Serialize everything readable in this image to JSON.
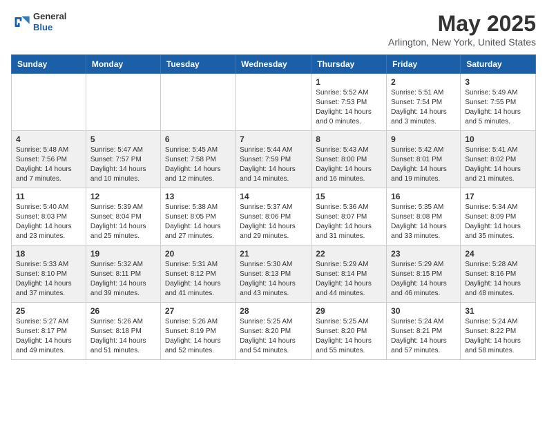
{
  "header": {
    "logo": {
      "general": "General",
      "blue": "Blue"
    },
    "title": "May 2025",
    "location": "Arlington, New York, United States"
  },
  "days_of_week": [
    "Sunday",
    "Monday",
    "Tuesday",
    "Wednesday",
    "Thursday",
    "Friday",
    "Saturday"
  ],
  "weeks": [
    [
      {
        "day": "",
        "info": ""
      },
      {
        "day": "",
        "info": ""
      },
      {
        "day": "",
        "info": ""
      },
      {
        "day": "",
        "info": ""
      },
      {
        "day": "1",
        "info": "Sunrise: 5:52 AM\nSunset: 7:53 PM\nDaylight: 14 hours and 0 minutes."
      },
      {
        "day": "2",
        "info": "Sunrise: 5:51 AM\nSunset: 7:54 PM\nDaylight: 14 hours and 3 minutes."
      },
      {
        "day": "3",
        "info": "Sunrise: 5:49 AM\nSunset: 7:55 PM\nDaylight: 14 hours and 5 minutes."
      }
    ],
    [
      {
        "day": "4",
        "info": "Sunrise: 5:48 AM\nSunset: 7:56 PM\nDaylight: 14 hours and 7 minutes."
      },
      {
        "day": "5",
        "info": "Sunrise: 5:47 AM\nSunset: 7:57 PM\nDaylight: 14 hours and 10 minutes."
      },
      {
        "day": "6",
        "info": "Sunrise: 5:45 AM\nSunset: 7:58 PM\nDaylight: 14 hours and 12 minutes."
      },
      {
        "day": "7",
        "info": "Sunrise: 5:44 AM\nSunset: 7:59 PM\nDaylight: 14 hours and 14 minutes."
      },
      {
        "day": "8",
        "info": "Sunrise: 5:43 AM\nSunset: 8:00 PM\nDaylight: 14 hours and 16 minutes."
      },
      {
        "day": "9",
        "info": "Sunrise: 5:42 AM\nSunset: 8:01 PM\nDaylight: 14 hours and 19 minutes."
      },
      {
        "day": "10",
        "info": "Sunrise: 5:41 AM\nSunset: 8:02 PM\nDaylight: 14 hours and 21 minutes."
      }
    ],
    [
      {
        "day": "11",
        "info": "Sunrise: 5:40 AM\nSunset: 8:03 PM\nDaylight: 14 hours and 23 minutes."
      },
      {
        "day": "12",
        "info": "Sunrise: 5:39 AM\nSunset: 8:04 PM\nDaylight: 14 hours and 25 minutes."
      },
      {
        "day": "13",
        "info": "Sunrise: 5:38 AM\nSunset: 8:05 PM\nDaylight: 14 hours and 27 minutes."
      },
      {
        "day": "14",
        "info": "Sunrise: 5:37 AM\nSunset: 8:06 PM\nDaylight: 14 hours and 29 minutes."
      },
      {
        "day": "15",
        "info": "Sunrise: 5:36 AM\nSunset: 8:07 PM\nDaylight: 14 hours and 31 minutes."
      },
      {
        "day": "16",
        "info": "Sunrise: 5:35 AM\nSunset: 8:08 PM\nDaylight: 14 hours and 33 minutes."
      },
      {
        "day": "17",
        "info": "Sunrise: 5:34 AM\nSunset: 8:09 PM\nDaylight: 14 hours and 35 minutes."
      }
    ],
    [
      {
        "day": "18",
        "info": "Sunrise: 5:33 AM\nSunset: 8:10 PM\nDaylight: 14 hours and 37 minutes."
      },
      {
        "day": "19",
        "info": "Sunrise: 5:32 AM\nSunset: 8:11 PM\nDaylight: 14 hours and 39 minutes."
      },
      {
        "day": "20",
        "info": "Sunrise: 5:31 AM\nSunset: 8:12 PM\nDaylight: 14 hours and 41 minutes."
      },
      {
        "day": "21",
        "info": "Sunrise: 5:30 AM\nSunset: 8:13 PM\nDaylight: 14 hours and 43 minutes."
      },
      {
        "day": "22",
        "info": "Sunrise: 5:29 AM\nSunset: 8:14 PM\nDaylight: 14 hours and 44 minutes."
      },
      {
        "day": "23",
        "info": "Sunrise: 5:29 AM\nSunset: 8:15 PM\nDaylight: 14 hours and 46 minutes."
      },
      {
        "day": "24",
        "info": "Sunrise: 5:28 AM\nSunset: 8:16 PM\nDaylight: 14 hours and 48 minutes."
      }
    ],
    [
      {
        "day": "25",
        "info": "Sunrise: 5:27 AM\nSunset: 8:17 PM\nDaylight: 14 hours and 49 minutes."
      },
      {
        "day": "26",
        "info": "Sunrise: 5:26 AM\nSunset: 8:18 PM\nDaylight: 14 hours and 51 minutes."
      },
      {
        "day": "27",
        "info": "Sunrise: 5:26 AM\nSunset: 8:19 PM\nDaylight: 14 hours and 52 minutes."
      },
      {
        "day": "28",
        "info": "Sunrise: 5:25 AM\nSunset: 8:20 PM\nDaylight: 14 hours and 54 minutes."
      },
      {
        "day": "29",
        "info": "Sunrise: 5:25 AM\nSunset: 8:20 PM\nDaylight: 14 hours and 55 minutes."
      },
      {
        "day": "30",
        "info": "Sunrise: 5:24 AM\nSunset: 8:21 PM\nDaylight: 14 hours and 57 minutes."
      },
      {
        "day": "31",
        "info": "Sunrise: 5:24 AM\nSunset: 8:22 PM\nDaylight: 14 hours and 58 minutes."
      }
    ]
  ]
}
